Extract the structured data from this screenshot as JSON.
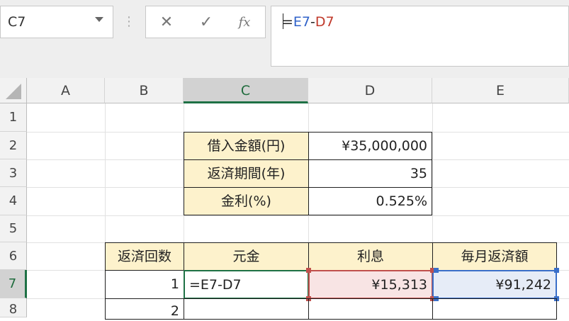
{
  "formula_bar": {
    "name_box": "C7",
    "dots": "⋮",
    "cancel_icon": "✕",
    "enter_icon": "✓",
    "fx_label": "fx",
    "formula_prefix": "=",
    "formula_ref_e": "E7",
    "formula_op": "-",
    "formula_ref_d": "D7"
  },
  "columns": [
    "A",
    "B",
    "C",
    "D",
    "E"
  ],
  "rows": [
    "1",
    "2",
    "3",
    "4",
    "5",
    "6",
    "7",
    "8"
  ],
  "info_table": [
    {
      "label": "借入金額(円)",
      "value": "¥35,000,000"
    },
    {
      "label": "返済期間(年)",
      "value": "35"
    },
    {
      "label": "金利(%)",
      "value": "0.525%"
    }
  ],
  "schedule": {
    "headers": [
      "返済回数",
      "元金",
      "利息",
      "毎月返済額"
    ],
    "row7": {
      "count": "1",
      "principal": "=E7-D7",
      "interest": "¥15,313",
      "payment": "¥91,242"
    },
    "row8": {
      "count": "2"
    }
  },
  "colors": {
    "selection": "#1e7145",
    "ref_d": "#c0504d",
    "ref_e": "#3a6fc9",
    "header_fill": "#fdf2cc"
  }
}
